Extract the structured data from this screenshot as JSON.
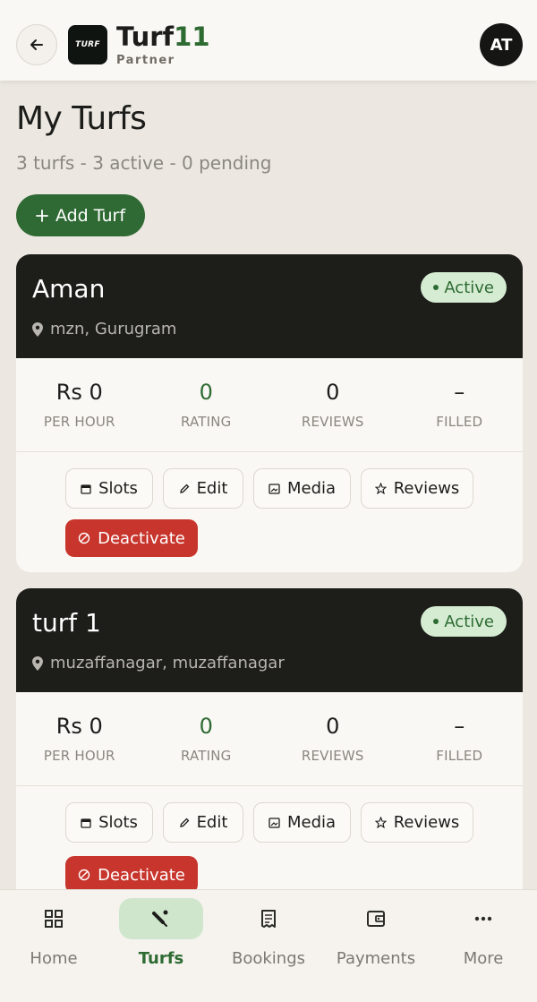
{
  "header": {
    "logo_text": "TURF",
    "brand_name": "Turf",
    "brand_accent": "11",
    "brand_sub": "Partner",
    "avatar": "AT"
  },
  "page": {
    "title": "My Turfs",
    "subtitle": "3 turfs - 3 active - 0 pending",
    "add_button": "Add Turf"
  },
  "turfs": [
    {
      "name": "Aman",
      "location": "mzn, Gurugram",
      "status": "Active",
      "stats": [
        {
          "value": "Rs 0",
          "label": "PER HOUR"
        },
        {
          "value": "0",
          "label": "RATING"
        },
        {
          "value": "0",
          "label": "REVIEWS"
        },
        {
          "value": "–",
          "label": "FILLED"
        }
      ]
    },
    {
      "name": "turf 1",
      "location": "muzaffanagar, muzaffanagar",
      "status": "Active",
      "stats": [
        {
          "value": "Rs 0",
          "label": "PER HOUR"
        },
        {
          "value": "0",
          "label": "RATING"
        },
        {
          "value": "0",
          "label": "REVIEWS"
        },
        {
          "value": "–",
          "label": "FILLED"
        }
      ]
    }
  ],
  "actions": {
    "slots": "Slots",
    "edit": "Edit",
    "media": "Media",
    "reviews": "Reviews",
    "deactivate": "Deactivate"
  },
  "nav": {
    "items": [
      {
        "label": "Home",
        "icon": "grid-icon"
      },
      {
        "label": "Turfs",
        "icon": "cricket-bat-icon",
        "active": true
      },
      {
        "label": "Bookings",
        "icon": "receipt-icon"
      },
      {
        "label": "Payments",
        "icon": "wallet-icon"
      },
      {
        "label": "More",
        "icon": "more-dots-icon"
      }
    ]
  },
  "colors": {
    "brand_green": "#2e6b33",
    "card_dark": "#1d1d1a",
    "danger": "#c7352c",
    "badge_bg": "#d5ecd2"
  }
}
